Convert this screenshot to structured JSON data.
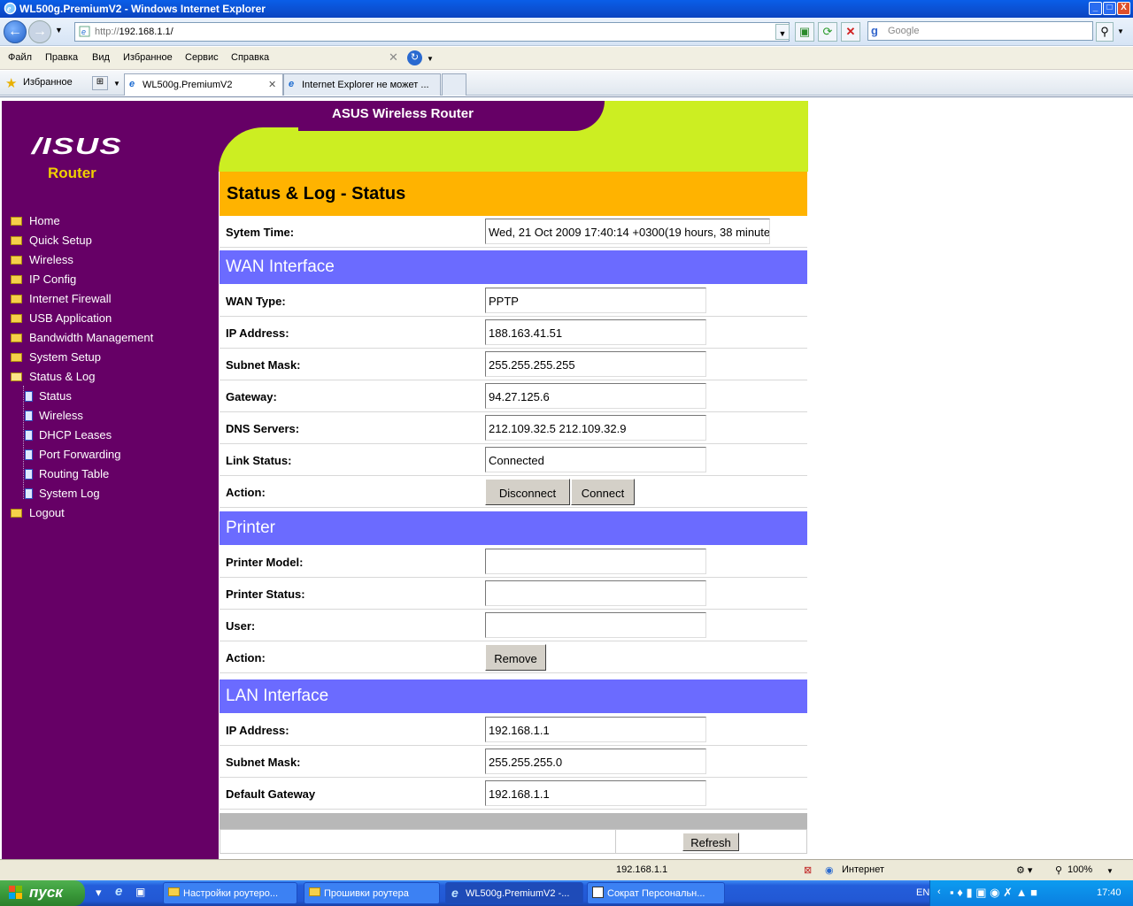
{
  "window": {
    "title": "WL500g.PremiumV2 - Windows Internet Explorer",
    "min": "_",
    "max": "□",
    "close": "X"
  },
  "address": {
    "proto": "http://",
    "host": "192.168.1.1/",
    "search_placeholder": "Google"
  },
  "menu": [
    "Файл",
    "Правка",
    "Вид",
    "Избранное",
    "Сервис",
    "Справка"
  ],
  "favorites_label": "Избранное",
  "tabs": [
    "WL500g.PremiumV2",
    "Internet Explorer не может ..."
  ],
  "header_title": "ASUS Wireless Router",
  "logo": {
    "brand": "/ISUS",
    "product": "Router"
  },
  "sidebar": {
    "items": [
      "Home",
      "Quick Setup",
      "Wireless",
      "IP Config",
      "Internet Firewall",
      "USB Application",
      "Bandwidth Management",
      "System Setup",
      "Status & Log"
    ],
    "sub_items": [
      "Status",
      "Wireless",
      "DHCP Leases",
      "Port Forwarding",
      "Routing Table",
      "System Log"
    ],
    "logout": "Logout"
  },
  "page_title": "Status & Log - Status",
  "system_time": {
    "label": "Sytem Time:",
    "value": "Wed, 21 Oct 2009 17:40:14 +0300(19 hours, 38 minute"
  },
  "wan": {
    "title": "WAN Interface",
    "type_label": "WAN Type:",
    "type": "PPTP",
    "ip_label": "IP Address:",
    "ip": "188.163.41.51",
    "mask_label": "Subnet Mask:",
    "mask": "255.255.255.255",
    "gw_label": "Gateway:",
    "gw": "94.27.125.6",
    "dns_label": "DNS Servers:",
    "dns": "212.109.32.5 212.109.32.9",
    "link_label": "Link Status:",
    "link": "Connected",
    "action_label": "Action:",
    "disconnect": "Disconnect",
    "connect": "Connect"
  },
  "printer": {
    "title": "Printer",
    "model_label": "Printer Model:",
    "model": "",
    "status_label": "Printer Status:",
    "status": "",
    "user_label": "User:",
    "user": "",
    "action_label": "Action:",
    "remove": "Remove"
  },
  "lan": {
    "title": "LAN Interface",
    "ip_label": "IP Address:",
    "ip": "192.168.1.1",
    "mask_label": "Subnet Mask:",
    "mask": "255.255.255.0",
    "gw_label": "Default Gateway",
    "gw": "192.168.1.1"
  },
  "refresh": "Refresh",
  "statusbar": {
    "url": "192.168.1.1",
    "zone": "Интернет",
    "zoom": "100%"
  },
  "taskbar": {
    "start": "пуск",
    "items": [
      "Настройки роутеро...",
      "Прошивки роутера",
      "WL500g.PremiumV2 -...",
      "Сократ Персональн..."
    ],
    "lang": "EN",
    "clock": "17:40"
  },
  "colors": {
    "sidebar": "#660066",
    "header": "#ccee22",
    "title_band": "#ffb300",
    "section_band": "#6b6bff"
  }
}
